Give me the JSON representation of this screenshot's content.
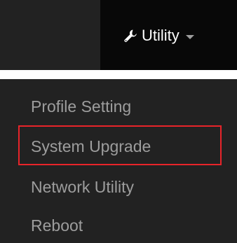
{
  "navbar": {
    "utility_label": "Utility",
    "toggle_icon": "wrench-icon",
    "dropdown_icon": "caret-down-icon"
  },
  "dropdown": {
    "items": [
      {
        "label": "Profile Setting"
      },
      {
        "label": "System Upgrade",
        "highlighted": true
      },
      {
        "label": "Network Utility"
      },
      {
        "label": "Reboot"
      }
    ]
  },
  "colors": {
    "navbar_bg": "#222222",
    "active_bg": "#080808",
    "menu_text": "#9d9d9d",
    "highlight_border": "#e8242a",
    "toggle_text": "#ffffff"
  }
}
